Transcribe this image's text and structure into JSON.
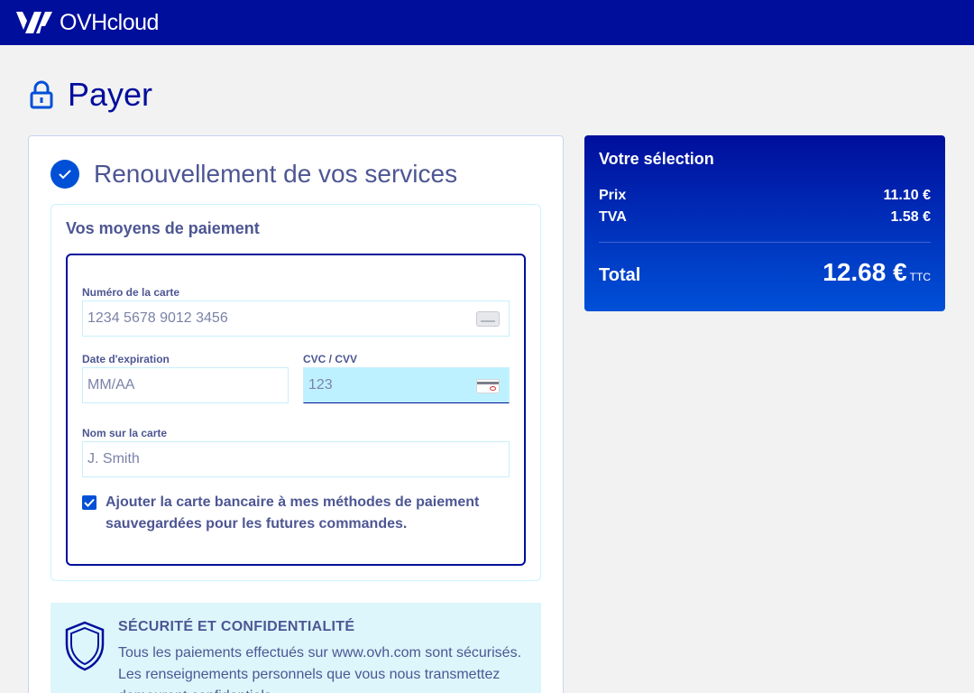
{
  "brand": {
    "name": "OVHcloud"
  },
  "page": {
    "title": "Payer"
  },
  "step": {
    "title": "Renouvellement de vos services"
  },
  "payment": {
    "heading": "Vos moyens de paiement",
    "card_number": {
      "label": "Numéro de la carte",
      "placeholder": "1234 5678 9012 3456"
    },
    "expiry": {
      "label": "Date d'expiration",
      "placeholder": "MM/AA"
    },
    "cvc": {
      "label": "CVC / CVV",
      "placeholder": "123"
    },
    "name": {
      "label": "Nom sur la carte",
      "placeholder": "J. Smith"
    },
    "save_card": {
      "checked": true,
      "label": "Ajouter la carte bancaire à mes méthodes de paiement sauvegardées pour les futures commandes."
    }
  },
  "security": {
    "title": "SÉCURITÉ ET CONFIDENTIALITÉ",
    "text": "Tous les paiements effectués sur www.ovh.com sont sécurisés. Les renseignements personnels que vous nous transmettez demeurent confidentiels."
  },
  "summary": {
    "title": "Votre sélection",
    "price_label": "Prix",
    "price_value": "11.10 €",
    "tax_label": "TVA",
    "tax_value": "1.58 €",
    "total_label": "Total",
    "total_value": "12.68 €",
    "total_suffix": "TTC"
  },
  "colors": {
    "brand_dark": "#000e9c",
    "brand_blue": "#0050d7",
    "text": "#4d5693",
    "active_field": "#bef1ff"
  }
}
